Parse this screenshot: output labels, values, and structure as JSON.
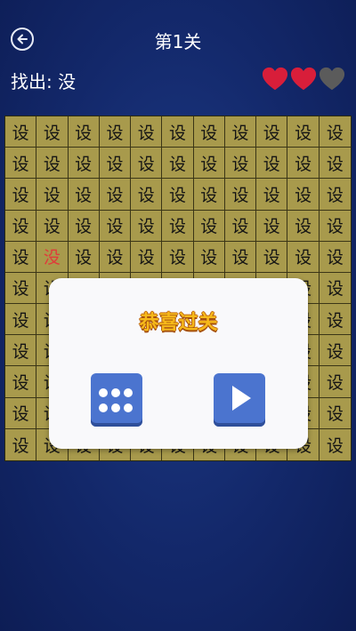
{
  "header": {
    "title": "第1关",
    "back_icon": "back-arrow-icon"
  },
  "task": {
    "label": "找出: 没"
  },
  "lives": {
    "total": 3,
    "remaining": 2,
    "full_color": "#d81e3a",
    "empty_color": "#5b5b5b"
  },
  "grid": {
    "rows": 11,
    "cols": 11,
    "char": "设",
    "target_char": "没",
    "target_row": 4,
    "target_col": 1,
    "target_color": "#e03a3a",
    "bg_color": "#a89a4c"
  },
  "modal": {
    "title": "恭喜过关",
    "menu_icon": "level-grid-icon",
    "next_icon": "play-icon",
    "button_color": "#4b74cf"
  }
}
